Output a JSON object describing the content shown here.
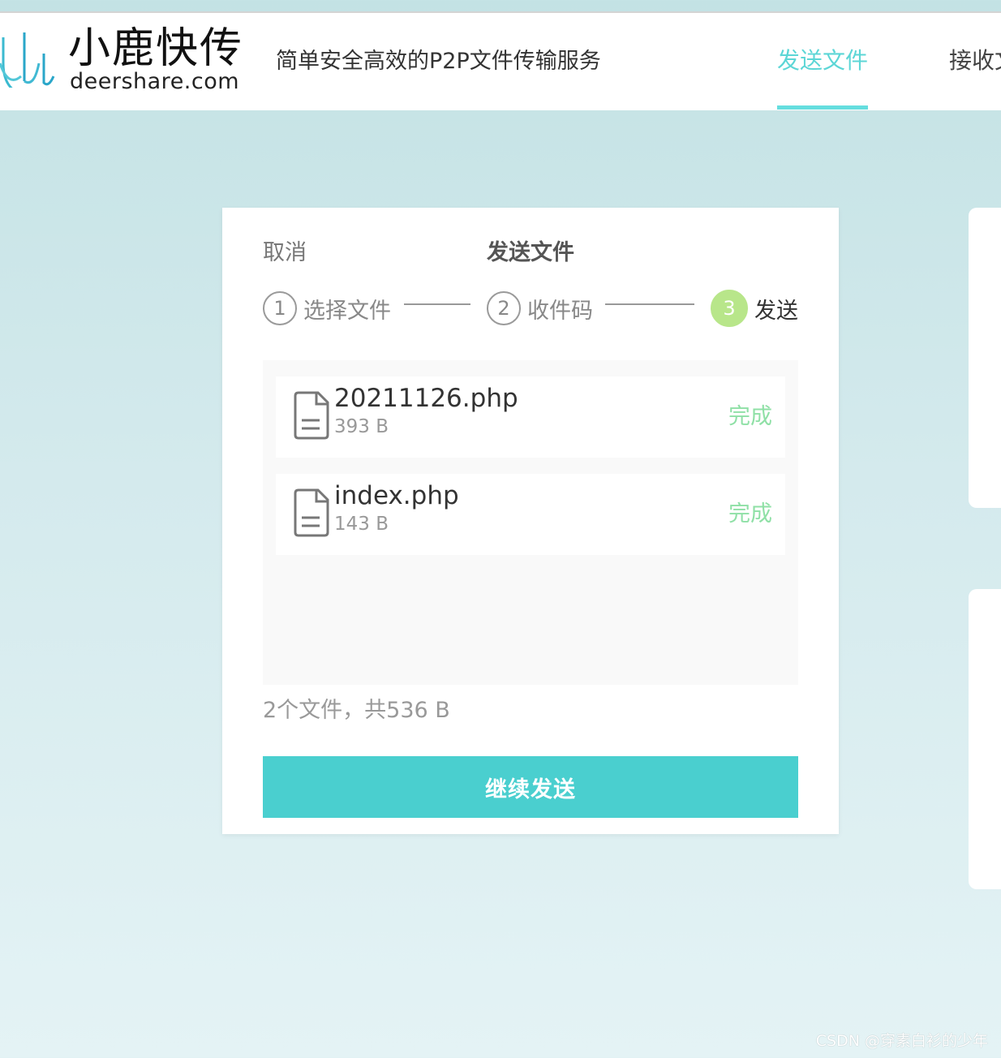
{
  "header": {
    "logo_cn": "小鹿快传",
    "logo_en": "deershare.com",
    "slogan": "简单安全高效的P2P文件传输服务",
    "nav": {
      "send": "发送文件",
      "receive": "接收文件"
    },
    "accent_color": "#5cd6d6"
  },
  "card": {
    "cancel": "取消",
    "title": "发送文件",
    "steps": [
      {
        "number": "1",
        "label": "选择文件"
      },
      {
        "number": "2",
        "label": "收件码"
      },
      {
        "number": "3",
        "label": "发送"
      }
    ],
    "files": [
      {
        "name": "20211126.php",
        "size": "393 B",
        "status": "完成"
      },
      {
        "name": "index.php",
        "size": "143 B",
        "status": "完成"
      }
    ],
    "summary": "2个文件，共536 B",
    "continue_button": "继续发送",
    "button_color": "#4acfcf",
    "status_color": "#8fe0a6",
    "active_step_color": "#b8e68a"
  },
  "watermark": "CSDN @穿素白衫的少年"
}
